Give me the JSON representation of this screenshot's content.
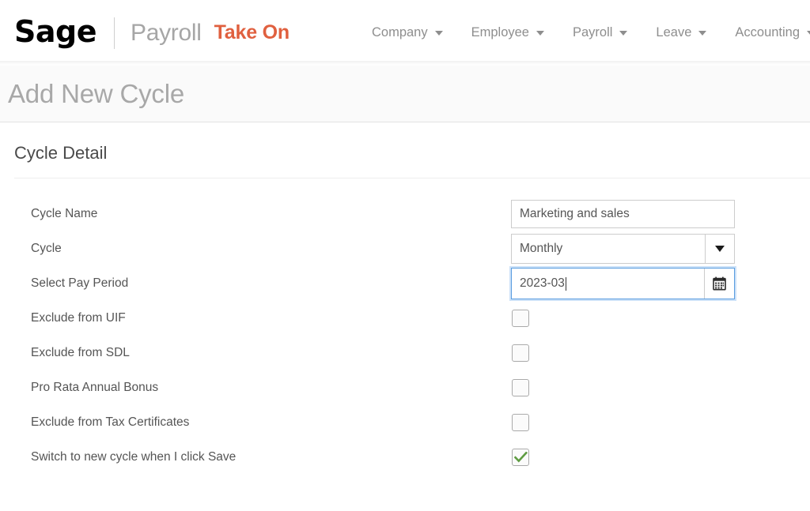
{
  "header": {
    "logo_text": "Sage",
    "logo_name": "sage-logo",
    "product": "Payroll",
    "module": "Take On",
    "accent_color": "#e0603f",
    "nav": [
      {
        "label": "Company",
        "icon": "chevron-down-icon"
      },
      {
        "label": "Employee",
        "icon": "chevron-down-icon"
      },
      {
        "label": "Payroll",
        "icon": "chevron-down-icon"
      },
      {
        "label": "Leave",
        "icon": "chevron-down-icon"
      },
      {
        "label": "Accounting",
        "icon": "chevron-down-icon"
      }
    ]
  },
  "page": {
    "title": "Add New Cycle",
    "section_title": "Cycle Detail"
  },
  "form": {
    "cycle_name": {
      "label": "Cycle Name",
      "value": "Marketing and sales",
      "placeholder": ""
    },
    "cycle": {
      "label": "Cycle",
      "value": "Monthly",
      "dropdown_icon": "caret-down-icon"
    },
    "pay_period": {
      "label": "Select Pay Period",
      "value": "2023-03",
      "calendar_icon": "calendar-icon",
      "focused": true
    },
    "checkboxes": [
      {
        "label": "Exclude from UIF",
        "checked": false
      },
      {
        "label": "Exclude from SDL",
        "checked": false
      },
      {
        "label": "Pro Rata Annual Bonus",
        "checked": false
      },
      {
        "label": "Exclude from Tax Certificates",
        "checked": false
      },
      {
        "label": "Switch to new cycle when I click Save",
        "checked": true
      }
    ],
    "check_color": "#5f9c42"
  }
}
